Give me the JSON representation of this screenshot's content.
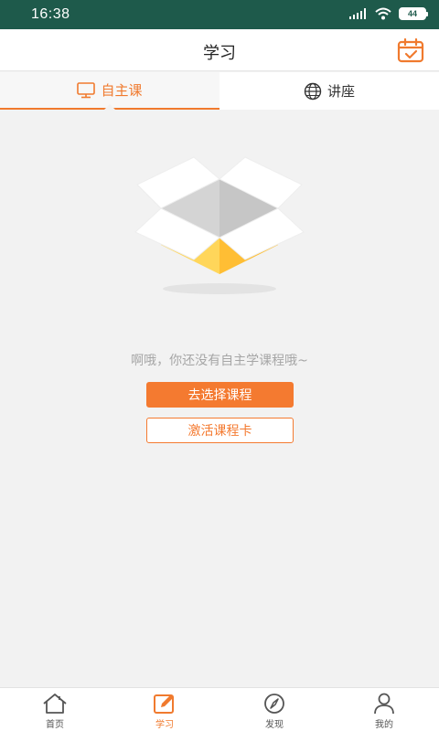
{
  "status_bar": {
    "time": "16:38",
    "battery": "44"
  },
  "header": {
    "title": "学习",
    "calendar_icon": "calendar-check-icon"
  },
  "tabs": [
    {
      "label": "自主课",
      "icon": "monitor-icon",
      "active": true
    },
    {
      "label": "讲座",
      "icon": "globe-icon",
      "active": false
    }
  ],
  "empty_state": {
    "message": "啊哦，你还没有自主学课程哦~",
    "primary_button": "去选择课程",
    "secondary_button": "激活课程卡",
    "icon": "empty-box-icon"
  },
  "bottom_nav": [
    {
      "label": "首页",
      "icon": "home-icon",
      "active": false
    },
    {
      "label": "学习",
      "icon": "edit-icon",
      "active": true
    },
    {
      "label": "发现",
      "icon": "compass-icon",
      "active": false
    },
    {
      "label": "我的",
      "icon": "user-icon",
      "active": false
    }
  ],
  "colors": {
    "accent": "#f47a30",
    "status_bar": "#1e5a4b",
    "background": "#f2f2f2"
  }
}
